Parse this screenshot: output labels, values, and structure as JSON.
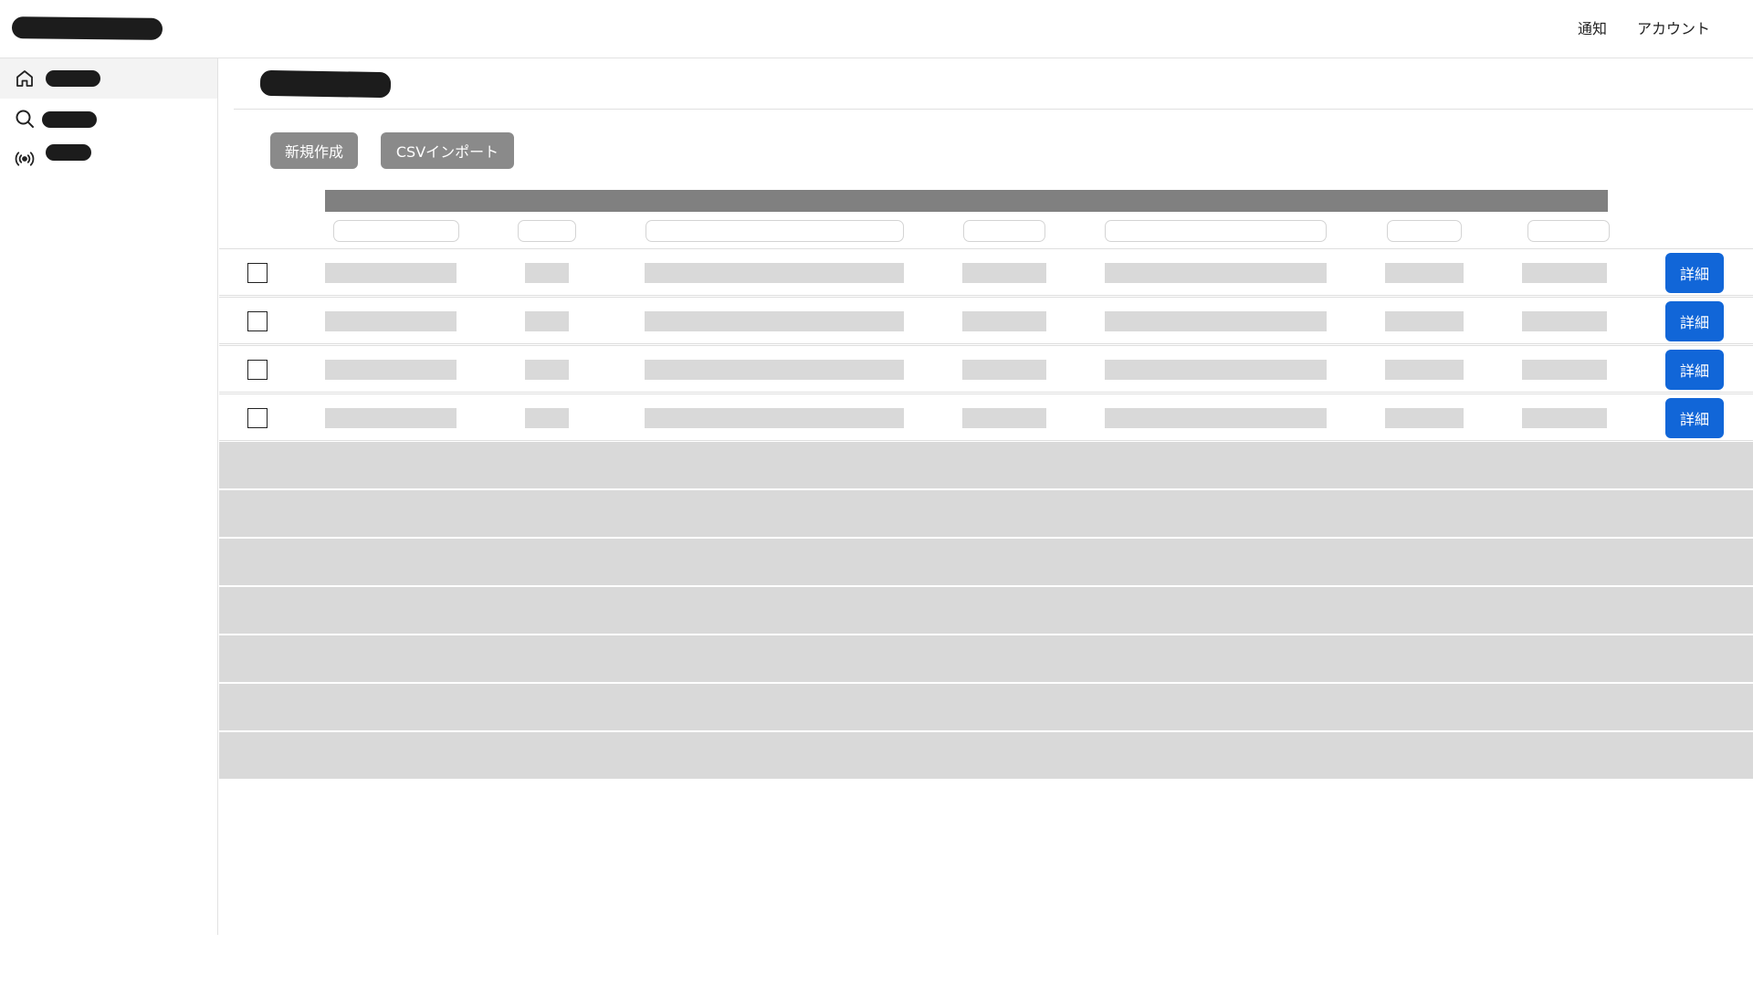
{
  "header": {
    "nav": [
      "通知",
      "アカウント"
    ]
  },
  "sidebar": {
    "items": [
      {
        "icon": "home-icon"
      },
      {
        "icon": "search-icon"
      },
      {
        "icon": "broadcast-icon"
      }
    ]
  },
  "toolbar": {
    "new_label": "新規作成",
    "csv_label": "CSVインポート"
  },
  "table": {
    "detail_label": "詳細",
    "row_count": 4,
    "placeholder_row_count": 7
  },
  "colors": {
    "accent": "#1166d8",
    "header_bar": "#808080",
    "skeleton": "#d9d9d9",
    "button_gray": "#8a8a8a"
  }
}
